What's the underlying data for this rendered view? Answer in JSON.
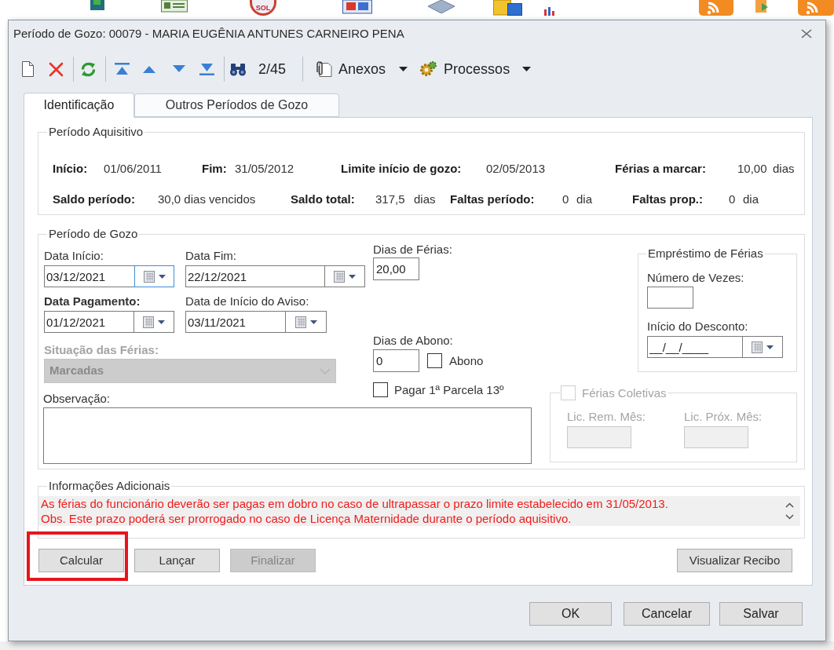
{
  "background_app": {
    "badge": "SOL"
  },
  "window": {
    "title": "Período de Gozo: 00079 - MARIA EUGÊNIA ANTUNES CARNEIRO PENA"
  },
  "toolbar": {
    "record_counter": "2/45",
    "menus": [
      {
        "label": "Anexos"
      },
      {
        "label": "Processos"
      }
    ]
  },
  "tabs": [
    {
      "label": "Identificação",
      "selected": true
    },
    {
      "label": "Outros Períodos de Gozo",
      "selected": false
    }
  ],
  "periodo_aquisitivo": {
    "title": "Período Aquisitivo",
    "items": [
      {
        "label": "Início:",
        "value": "01/06/2011"
      },
      {
        "label": "Fim:",
        "value": "31/05/2012"
      },
      {
        "label": "Limite início de gozo:",
        "value": "02/05/2013"
      },
      {
        "label": "Férias a marcar:",
        "value": "10,00",
        "unit": "dias"
      },
      {
        "label": "Saldo período:",
        "value": "30,0 dias vencidos"
      },
      {
        "label": "Saldo total:",
        "value": "317,5",
        "unit": "dias"
      },
      {
        "label": "Faltas período:",
        "value": "0",
        "unit": "dia"
      },
      {
        "label": "Faltas prop.:",
        "value": "0",
        "unit": "dia"
      }
    ]
  },
  "periodo_gozo": {
    "title": "Período de Gozo",
    "data_inicio": {
      "label": "Data Início:",
      "value": "03/12/2021",
      "required": false,
      "picker_focused": true
    },
    "data_fim": {
      "label": "Data Fim:",
      "value": "22/12/2021",
      "required": false,
      "picker_focused": false
    },
    "dias_ferias": {
      "label": "Dias de Férias:",
      "value": "20,00"
    },
    "data_pagamento": {
      "label": "Data Pagamento:",
      "value": "01/12/2021",
      "required": true,
      "picker_focused": false
    },
    "data_inicio_aviso": {
      "label": "Data de Início do Aviso:",
      "value": "03/11/2021",
      "required": false,
      "picker_focused": false
    },
    "situacao": {
      "label": "Situação das Férias:",
      "value": "Marcadas",
      "required": true,
      "disabled": true
    },
    "dias_abono": {
      "label": "Dias de Abono:",
      "value": "0"
    },
    "abono": {
      "label": "Abono",
      "checked": false
    },
    "pagar_parcela_13": {
      "label": "Pagar 1ª Parcela 13º",
      "checked": false
    },
    "observacao": {
      "label": "Observação:"
    },
    "emprestimo": {
      "title": "Empréstimo de Férias",
      "numero_vezes": {
        "label": "Número de Vezes:"
      },
      "inicio_desconto": {
        "label": "Início do Desconto:",
        "value": "__/__/____",
        "picker_focused": false
      }
    },
    "ferias_coletivas": {
      "label": "Férias Coletivas",
      "checked": false,
      "disabled": true,
      "fields": [
        {
          "label": "Lic. Rem. Mês:"
        },
        {
          "label": "Lic. Próx. Mês:"
        }
      ]
    }
  },
  "informacoes_adicionais": {
    "title": "Informações Adicionais",
    "lines": [
      "As férias do funcionário deverão ser pagas em dobro no caso de ultrapassar o prazo limite estabelecido em 31/05/2013.",
      "Obs. Este prazo poderá ser prorrogado no caso de Licença Maternidade durante o período aquisitivo."
    ]
  },
  "action_buttons": [
    {
      "label": "Calcular",
      "disabled": false,
      "highlighted": true
    },
    {
      "label": "Lançar",
      "disabled": false,
      "highlighted": false
    },
    {
      "label": "Finalizar",
      "disabled": true,
      "highlighted": false
    }
  ],
  "receipt_button": {
    "label": "Visualizar Recibo"
  },
  "dialog_buttons": [
    {
      "label": "OK"
    },
    {
      "label": "Cancelar"
    },
    {
      "label": "Salvar"
    }
  ]
}
